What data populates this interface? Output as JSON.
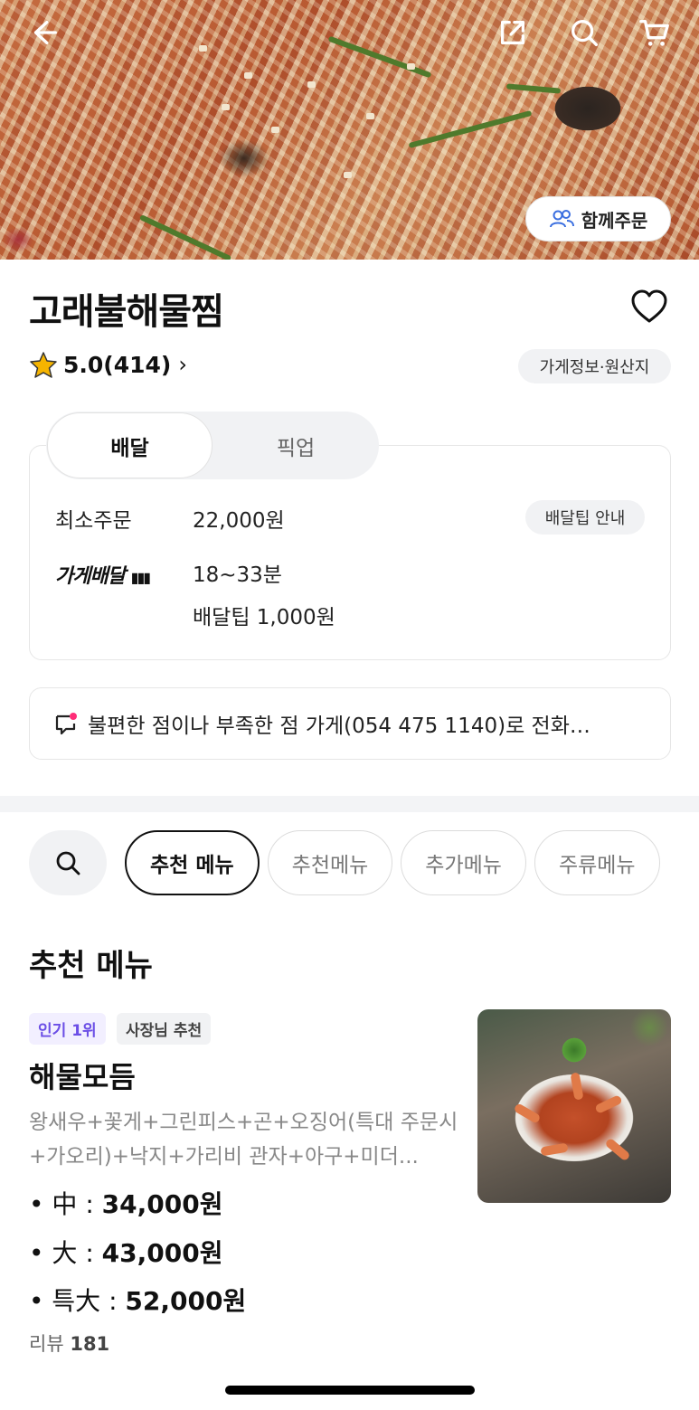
{
  "store": {
    "name": "고래불해물찜",
    "rating": "5.0(414)",
    "info_button": "가게정보·원산지",
    "with_order_button": "함께주문"
  },
  "delivery": {
    "tabs": [
      "배달",
      "픽업"
    ],
    "active_tab": "배달",
    "min_order_label": "최소주문",
    "min_order_value": "22,000원",
    "tip_guide_button": "배달팁 안내",
    "store_delivery_label": "가게배달",
    "time": "18~33분",
    "tip": "배달팁 1,000원"
  },
  "notice": {
    "text": "불편한 점이나 부족한 점 가게(054 475 1140)로 전화…"
  },
  "categories": {
    "items": [
      "추천 메뉴",
      "추천메뉴",
      "추가메뉴",
      "주류메뉴"
    ],
    "active": "추천 메뉴"
  },
  "section": {
    "title": "추천 메뉴"
  },
  "menu_item": {
    "badges": [
      "인기 1위",
      "사장님 추천"
    ],
    "name": "해물모듬",
    "description": "왕새우+꽃게+그린피스+곤+오징어(특대 주문시 +가오리)+낙지+가리비 관자+아구+미더...",
    "prices": [
      {
        "size": "• 中 : ",
        "price": "34,000원"
      },
      {
        "size": "• 大 : ",
        "price": "43,000원"
      },
      {
        "size": "• 특大 : ",
        "price": "52,000원"
      }
    ],
    "review_label": "리뷰",
    "review_count": "181"
  },
  "colors": {
    "accent_purple": "#6b4ee6",
    "star": "#f5b400",
    "notice_dot": "#ff2d78"
  },
  "icons": {
    "back": "back-arrow-icon",
    "share": "share-icon",
    "search": "search-icon",
    "cart": "cart-icon",
    "favorite": "heart-icon",
    "people": "people-icon",
    "star": "star-icon",
    "chat": "chat-notice-icon"
  }
}
